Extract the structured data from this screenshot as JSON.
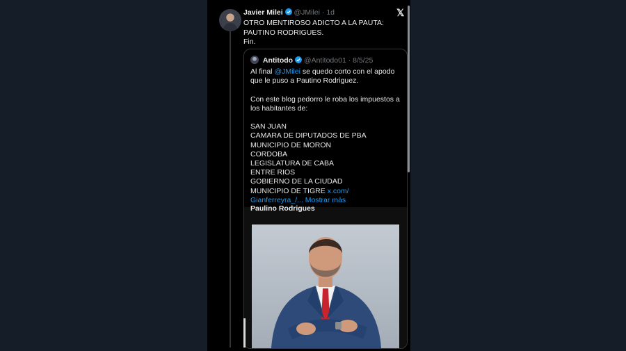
{
  "tweet": {
    "author_name": "Javier Milei",
    "handle": "@JMilei",
    "separator": "·",
    "time": "1d",
    "text_lines": [
      "OTRO MENTIROSO ADICTO A LA PAUTA:",
      "PAUTINO RODRIGUES.",
      "Fin."
    ],
    "platform_icon": "x-logo-icon"
  },
  "quoted": {
    "author_name": "Antitodo",
    "handle": "@Antitodo01",
    "separator": "·",
    "date": "8/5/25",
    "line1_prefix": "Al final ",
    "line1_mention": "@JMilei",
    "line1_suffix": " se quedo corto con el apodo que le puso a Pautino Rodriguez.",
    "para2": "Con este blog pedorro le roba los impuestos a los habitantes de:",
    "places": [
      "SAN JUAN",
      "CAMARA DE DIPUTADOS DE PBA",
      "MUNICIPIO DE MORON",
      "CORDOBA",
      "LEGISLATURA DE CABA",
      "ENTRE RIOS",
      "GOBIERNO DE LA CIUDAD"
    ],
    "last_place": "MUNICIPIO DE TIGRE",
    "link_text": "x.com/Gianferreyra_/...",
    "link_part1": "x.com/",
    "link_part2": "Gianferreyra_/...",
    "show_more": "Mostrar más",
    "media_title": "Paulino Rodrigues"
  },
  "colors": {
    "background": "#151d28",
    "panel": "#000000",
    "link": "#1d9bf0",
    "muted": "#71767b",
    "verified": "#1d9bf0"
  }
}
